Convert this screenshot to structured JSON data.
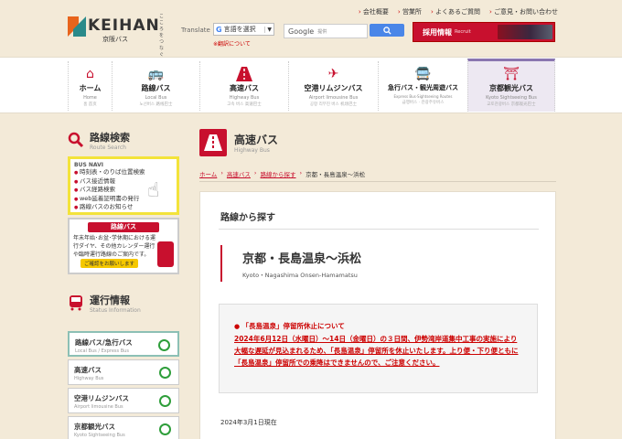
{
  "header": {
    "logo_tag": "こころをつなぐ つくろう",
    "logo_text": "KEIHAN",
    "logo_sub": "京阪バス",
    "top_links": [
      "会社概要",
      "営業所",
      "よくあるご質問",
      "ご意見・お問い合わせ"
    ],
    "translate_label": "Translate",
    "translate_select": "言語を選択",
    "translate_note": "※翻訳について",
    "search_brand": "Google",
    "search_placeholder": "提供",
    "search_button_icon": "search-icon",
    "recruit_label": "採用情報",
    "recruit_sub": "Recruit"
  },
  "nav": [
    {
      "label": "ホーム",
      "en": "Home",
      "multi": "홈 首页",
      "icon": "home-icon"
    },
    {
      "label": "路線バス",
      "en": "Local Bus",
      "multi": "노선버스 路线巴士",
      "icon": "local-bus-icon"
    },
    {
      "label": "高速バス",
      "en": "Highway Bus",
      "multi": "고속 버스 高速巴士",
      "icon": "highway-icon"
    },
    {
      "label": "空港リムジンバス",
      "en": "Airport limousine Bus",
      "multi": "공항 리무진 버스 机场巴士",
      "icon": "airplane-icon"
    },
    {
      "label": "急行バス・観光周遊バス",
      "en": "Express Bus·Sightseeing Routes",
      "multi": "급행버스 · 관광주유버스",
      "icon": "express-bus-icon"
    },
    {
      "label": "京都観光バス",
      "en": "Kyoto Sightseeing Bus",
      "multi": "교토관광버스 京都观光巴士",
      "icon": "torii-icon"
    }
  ],
  "sidebar": {
    "route_search_title": "路線検索",
    "route_search_en": "Route Search",
    "busnavi_logo": "BUS NAVI",
    "busnavi_items": [
      "時刻表・のりば位置検索",
      "バス接近情報",
      "バス経路検索",
      "web延着証明書の発行",
      "路線バスのお知らせ"
    ],
    "rosen_title": "路線バス",
    "rosen_body": "年末年始･お盆･学休期における運行ダイヤ、その他カレンダー運行や臨時運行路線のご案内です。",
    "rosen_button": "ご確認をお願いします",
    "status_title": "運行情報",
    "status_en": "Status Information",
    "status_items": [
      {
        "name": "路線バス/急行バス",
        "en": "Local Bus / Express Bus"
      },
      {
        "name": "高速バス",
        "en": "Highway Bus"
      },
      {
        "name": "空港リムジンバス",
        "en": "Airport limousine Bus"
      },
      {
        "name": "京都観光バス",
        "en": "Kyoto Sightseeing Bus"
      }
    ]
  },
  "main": {
    "page_title": "高速バス",
    "page_title_en": "Highway Bus",
    "breadcrumb": [
      "ホーム",
      "高速バス",
      "路線から探す",
      "京都・長島温泉～浜松"
    ],
    "section_title": "路線から探す",
    "route_jp": "京都・長島温泉～浜松",
    "route_en": "Kyoto・Nagashima Onsen-Hamamatsu",
    "notice_title": "「長島温泉」停留所休止について",
    "notice_body": "2024年6月12日（水曜日）～14日（金曜日）の３日間、伊勢湾岸道集中工事の実施により大幅な遅延が見込まれるため、「長島温泉」停留所を休止いたします。上り便・下り便ともに「長島温泉」停留所での乗降はできませんので、ご注意ください。",
    "date": "2024年3月1日現在"
  },
  "colors": {
    "accent": "#c8102e",
    "background": "#f3ead8",
    "status_ok": "#2e9e3a",
    "busnavi_border": "#f3e33a"
  }
}
